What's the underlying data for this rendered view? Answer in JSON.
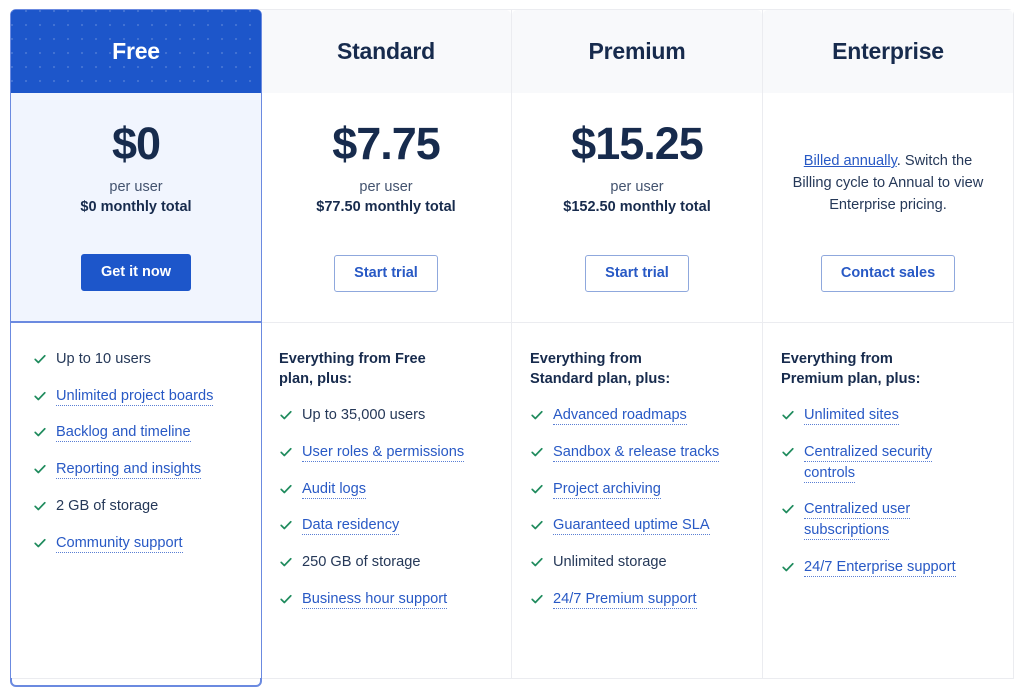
{
  "icons": {
    "check": "check-icon"
  },
  "colors": {
    "featured_blue": "#1d56ca",
    "featured_bg": "#f1f5fe",
    "featured_border": "#6b8ae0",
    "link_blue": "#2859c5",
    "check_green": "#1f8b5d",
    "heading_navy": "#172b4d",
    "divider_gray": "#ebecf0"
  },
  "plans": [
    {
      "name": "Free",
      "featured": true,
      "price": "$0",
      "unit": "per user",
      "total": "$0 monthly total",
      "note": null,
      "note_link": null,
      "note_rest": null,
      "cta": "Get it now",
      "cta_style": "primary",
      "feature_heading": null,
      "features": [
        {
          "label": "Up to 10 users",
          "link": false
        },
        {
          "label": "Unlimited project boards",
          "link": true
        },
        {
          "label": "Backlog and timeline",
          "link": true
        },
        {
          "label": "Reporting and insights",
          "link": true
        },
        {
          "label": "2 GB of storage",
          "link": false
        },
        {
          "label": "Community support",
          "link": true
        }
      ]
    },
    {
      "name": "Standard",
      "featured": false,
      "price": "$7.75",
      "unit": "per user",
      "total": "$77.50 monthly total",
      "note": null,
      "note_link": null,
      "note_rest": null,
      "cta": "Start trial",
      "cta_style": "outline",
      "feature_heading": "Everything from Free plan, plus:",
      "features": [
        {
          "label": "Up to 35,000 users",
          "link": false
        },
        {
          "label": "User roles & permissions",
          "link": true
        },
        {
          "label": "Audit logs",
          "link": true
        },
        {
          "label": "Data residency",
          "link": true
        },
        {
          "label": "250 GB of storage",
          "link": false
        },
        {
          "label": "Business hour support",
          "link": true
        }
      ]
    },
    {
      "name": "Premium",
      "featured": false,
      "price": "$15.25",
      "unit": "per user",
      "total": "$152.50 monthly total",
      "note": null,
      "note_link": null,
      "note_rest": null,
      "cta": "Start trial",
      "cta_style": "outline",
      "feature_heading": "Everything from Standard plan, plus:",
      "features": [
        {
          "label": "Advanced roadmaps",
          "link": true
        },
        {
          "label": "Sandbox & release tracks",
          "link": true
        },
        {
          "label": "Project archiving",
          "link": true
        },
        {
          "label": "Guaranteed uptime SLA",
          "link": true
        },
        {
          "label": "Unlimited storage",
          "link": false
        },
        {
          "label": "24/7 Premium support",
          "link": true
        }
      ]
    },
    {
      "name": "Enterprise",
      "featured": false,
      "price": null,
      "unit": null,
      "total": null,
      "note_link": "Billed annually",
      "note_rest": ". Switch the Billing cycle to Annual to view Enterprise pricing.",
      "cta": "Contact sales",
      "cta_style": "outline",
      "feature_heading": "Everything from Premium plan, plus:",
      "features": [
        {
          "label": "Unlimited sites",
          "link": true
        },
        {
          "label": "Centralized security controls",
          "link": true
        },
        {
          "label": "Centralized user subscriptions",
          "link": true
        },
        {
          "label": "24/7 Enterprise support",
          "link": true
        }
      ]
    }
  ]
}
